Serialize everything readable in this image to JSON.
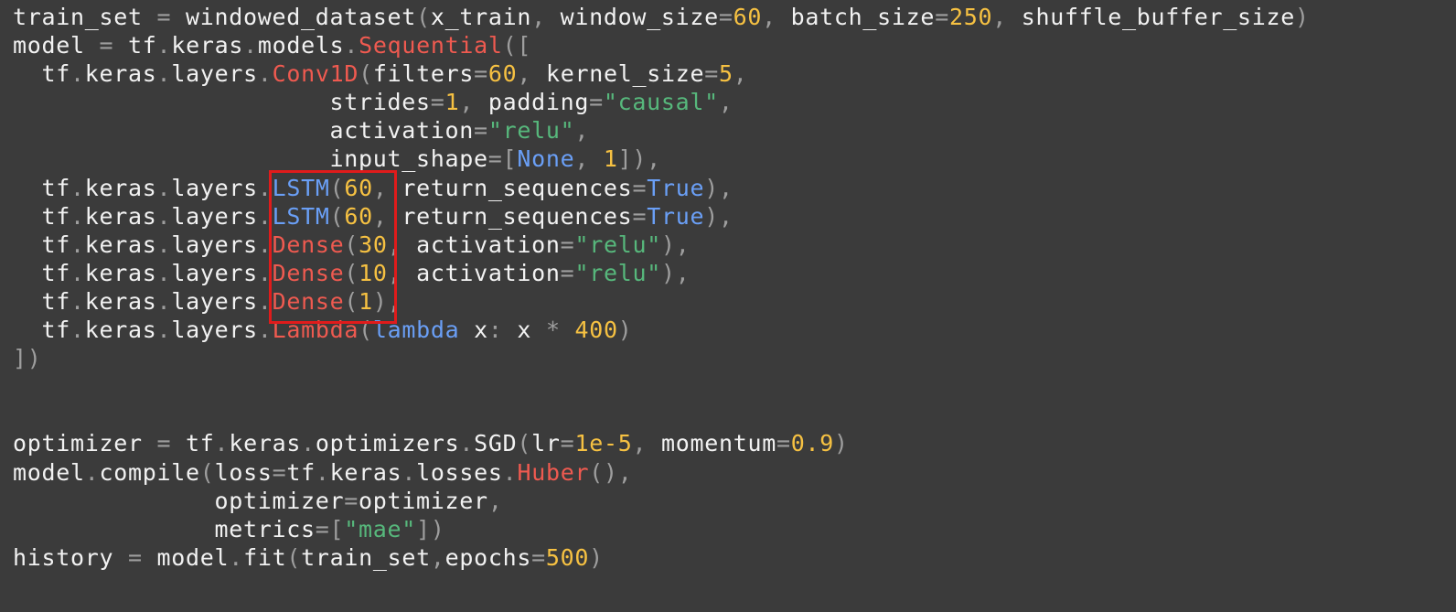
{
  "code": {
    "lines": [
      {
        "tokens": [
          {
            "t": "train_set",
            "k": "plain"
          },
          {
            "t": " = ",
            "k": "punct"
          },
          {
            "t": "windowed_dataset",
            "k": "plain"
          },
          {
            "t": "(",
            "k": "punct"
          },
          {
            "t": "x_train",
            "k": "plain"
          },
          {
            "t": ", ",
            "k": "punct"
          },
          {
            "t": "window_size",
            "k": "plain"
          },
          {
            "t": "=",
            "k": "punct"
          },
          {
            "t": "60",
            "k": "num"
          },
          {
            "t": ", ",
            "k": "punct"
          },
          {
            "t": "batch_size",
            "k": "plain"
          },
          {
            "t": "=",
            "k": "punct"
          },
          {
            "t": "250",
            "k": "num"
          },
          {
            "t": ", ",
            "k": "punct"
          },
          {
            "t": "shuffle_buffer_size",
            "k": "plain"
          },
          {
            "t": ")",
            "k": "punct"
          }
        ]
      },
      {
        "tokens": [
          {
            "t": "model",
            "k": "plain"
          },
          {
            "t": " = ",
            "k": "punct"
          },
          {
            "t": "tf",
            "k": "plain"
          },
          {
            "t": ".",
            "k": "punct"
          },
          {
            "t": "keras",
            "k": "plain"
          },
          {
            "t": ".",
            "k": "punct"
          },
          {
            "t": "models",
            "k": "plain"
          },
          {
            "t": ".",
            "k": "punct"
          },
          {
            "t": "Sequential",
            "k": "class"
          },
          {
            "t": "([",
            "k": "punct"
          }
        ]
      },
      {
        "tokens": [
          {
            "t": "  tf",
            "k": "plain"
          },
          {
            "t": ".",
            "k": "punct"
          },
          {
            "t": "keras",
            "k": "plain"
          },
          {
            "t": ".",
            "k": "punct"
          },
          {
            "t": "layers",
            "k": "plain"
          },
          {
            "t": ".",
            "k": "punct"
          },
          {
            "t": "Conv1D",
            "k": "class"
          },
          {
            "t": "(",
            "k": "punct"
          },
          {
            "t": "filters",
            "k": "plain"
          },
          {
            "t": "=",
            "k": "punct"
          },
          {
            "t": "60",
            "k": "num"
          },
          {
            "t": ", ",
            "k": "punct"
          },
          {
            "t": "kernel_size",
            "k": "plain"
          },
          {
            "t": "=",
            "k": "punct"
          },
          {
            "t": "5",
            "k": "num"
          },
          {
            "t": ",",
            "k": "punct"
          }
        ]
      },
      {
        "tokens": [
          {
            "t": "                      strides",
            "k": "plain"
          },
          {
            "t": "=",
            "k": "punct"
          },
          {
            "t": "1",
            "k": "num"
          },
          {
            "t": ", ",
            "k": "punct"
          },
          {
            "t": "padding",
            "k": "plain"
          },
          {
            "t": "=",
            "k": "punct"
          },
          {
            "t": "\"causal\"",
            "k": "str"
          },
          {
            "t": ",",
            "k": "punct"
          }
        ]
      },
      {
        "tokens": [
          {
            "t": "                      activation",
            "k": "plain"
          },
          {
            "t": "=",
            "k": "punct"
          },
          {
            "t": "\"relu\"",
            "k": "str"
          },
          {
            "t": ",",
            "k": "punct"
          }
        ]
      },
      {
        "tokens": [
          {
            "t": "                      input_shape",
            "k": "plain"
          },
          {
            "t": "=[",
            "k": "punct"
          },
          {
            "t": "None",
            "k": "const"
          },
          {
            "t": ", ",
            "k": "punct"
          },
          {
            "t": "1",
            "k": "num"
          },
          {
            "t": "]),",
            "k": "punct"
          }
        ]
      },
      {
        "tokens": [
          {
            "t": "  tf",
            "k": "plain"
          },
          {
            "t": ".",
            "k": "punct"
          },
          {
            "t": "keras",
            "k": "plain"
          },
          {
            "t": ".",
            "k": "punct"
          },
          {
            "t": "layers",
            "k": "plain"
          },
          {
            "t": ".",
            "k": "punct"
          },
          {
            "t": "LSTM",
            "k": "const"
          },
          {
            "t": "(",
            "k": "punct"
          },
          {
            "t": "60",
            "k": "num"
          },
          {
            "t": ", ",
            "k": "punct"
          },
          {
            "t": "return_sequences",
            "k": "plain"
          },
          {
            "t": "=",
            "k": "punct"
          },
          {
            "t": "True",
            "k": "const"
          },
          {
            "t": "),",
            "k": "punct"
          }
        ]
      },
      {
        "tokens": [
          {
            "t": "  tf",
            "k": "plain"
          },
          {
            "t": ".",
            "k": "punct"
          },
          {
            "t": "keras",
            "k": "plain"
          },
          {
            "t": ".",
            "k": "punct"
          },
          {
            "t": "layers",
            "k": "plain"
          },
          {
            "t": ".",
            "k": "punct"
          },
          {
            "t": "LSTM",
            "k": "const"
          },
          {
            "t": "(",
            "k": "punct"
          },
          {
            "t": "60",
            "k": "num"
          },
          {
            "t": ", ",
            "k": "punct"
          },
          {
            "t": "return_sequences",
            "k": "plain"
          },
          {
            "t": "=",
            "k": "punct"
          },
          {
            "t": "True",
            "k": "const"
          },
          {
            "t": "),",
            "k": "punct"
          }
        ]
      },
      {
        "tokens": [
          {
            "t": "  tf",
            "k": "plain"
          },
          {
            "t": ".",
            "k": "punct"
          },
          {
            "t": "keras",
            "k": "plain"
          },
          {
            "t": ".",
            "k": "punct"
          },
          {
            "t": "layers",
            "k": "plain"
          },
          {
            "t": ".",
            "k": "punct"
          },
          {
            "t": "Dense",
            "k": "class"
          },
          {
            "t": "(",
            "k": "punct"
          },
          {
            "t": "30",
            "k": "num"
          },
          {
            "t": ", ",
            "k": "punct"
          },
          {
            "t": "activation",
            "k": "plain"
          },
          {
            "t": "=",
            "k": "punct"
          },
          {
            "t": "\"relu\"",
            "k": "str"
          },
          {
            "t": "),",
            "k": "punct"
          }
        ]
      },
      {
        "tokens": [
          {
            "t": "  tf",
            "k": "plain"
          },
          {
            "t": ".",
            "k": "punct"
          },
          {
            "t": "keras",
            "k": "plain"
          },
          {
            "t": ".",
            "k": "punct"
          },
          {
            "t": "layers",
            "k": "plain"
          },
          {
            "t": ".",
            "k": "punct"
          },
          {
            "t": "Dense",
            "k": "class"
          },
          {
            "t": "(",
            "k": "punct"
          },
          {
            "t": "10",
            "k": "num"
          },
          {
            "t": ", ",
            "k": "punct"
          },
          {
            "t": "activation",
            "k": "plain"
          },
          {
            "t": "=",
            "k": "punct"
          },
          {
            "t": "\"relu\"",
            "k": "str"
          },
          {
            "t": "),",
            "k": "punct"
          }
        ]
      },
      {
        "tokens": [
          {
            "t": "  tf",
            "k": "plain"
          },
          {
            "t": ".",
            "k": "punct"
          },
          {
            "t": "keras",
            "k": "plain"
          },
          {
            "t": ".",
            "k": "punct"
          },
          {
            "t": "layers",
            "k": "plain"
          },
          {
            "t": ".",
            "k": "punct"
          },
          {
            "t": "Dense",
            "k": "class"
          },
          {
            "t": "(",
            "k": "punct"
          },
          {
            "t": "1",
            "k": "num"
          },
          {
            "t": "),",
            "k": "punct"
          }
        ]
      },
      {
        "tokens": [
          {
            "t": "  tf",
            "k": "plain"
          },
          {
            "t": ".",
            "k": "punct"
          },
          {
            "t": "keras",
            "k": "plain"
          },
          {
            "t": ".",
            "k": "punct"
          },
          {
            "t": "layers",
            "k": "plain"
          },
          {
            "t": ".",
            "k": "punct"
          },
          {
            "t": "Lambda",
            "k": "class"
          },
          {
            "t": "(",
            "k": "punct"
          },
          {
            "t": "lambda",
            "k": "const"
          },
          {
            "t": " x",
            "k": "plain"
          },
          {
            "t": ": ",
            "k": "punct"
          },
          {
            "t": "x ",
            "k": "plain"
          },
          {
            "t": "* ",
            "k": "punct"
          },
          {
            "t": "400",
            "k": "num"
          },
          {
            "t": ")",
            "k": "punct"
          }
        ]
      },
      {
        "tokens": [
          {
            "t": "])",
            "k": "punct"
          }
        ]
      },
      {
        "tokens": []
      },
      {
        "tokens": []
      },
      {
        "tokens": [
          {
            "t": "optimizer",
            "k": "plain"
          },
          {
            "t": " = ",
            "k": "punct"
          },
          {
            "t": "tf",
            "k": "plain"
          },
          {
            "t": ".",
            "k": "punct"
          },
          {
            "t": "keras",
            "k": "plain"
          },
          {
            "t": ".",
            "k": "punct"
          },
          {
            "t": "optimizers",
            "k": "plain"
          },
          {
            "t": ".",
            "k": "punct"
          },
          {
            "t": "SGD",
            "k": "plain"
          },
          {
            "t": "(",
            "k": "punct"
          },
          {
            "t": "lr",
            "k": "plain"
          },
          {
            "t": "=",
            "k": "punct"
          },
          {
            "t": "1e-5",
            "k": "num"
          },
          {
            "t": ", ",
            "k": "punct"
          },
          {
            "t": "momentum",
            "k": "plain"
          },
          {
            "t": "=",
            "k": "punct"
          },
          {
            "t": "0.9",
            "k": "num"
          },
          {
            "t": ")",
            "k": "punct"
          }
        ]
      },
      {
        "tokens": [
          {
            "t": "model",
            "k": "plain"
          },
          {
            "t": ".",
            "k": "punct"
          },
          {
            "t": "compile",
            "k": "plain"
          },
          {
            "t": "(",
            "k": "punct"
          },
          {
            "t": "loss",
            "k": "plain"
          },
          {
            "t": "=",
            "k": "punct"
          },
          {
            "t": "tf",
            "k": "plain"
          },
          {
            "t": ".",
            "k": "punct"
          },
          {
            "t": "keras",
            "k": "plain"
          },
          {
            "t": ".",
            "k": "punct"
          },
          {
            "t": "losses",
            "k": "plain"
          },
          {
            "t": ".",
            "k": "punct"
          },
          {
            "t": "Huber",
            "k": "class"
          },
          {
            "t": "(),",
            "k": "punct"
          }
        ]
      },
      {
        "tokens": [
          {
            "t": "              optimizer",
            "k": "plain"
          },
          {
            "t": "=",
            "k": "punct"
          },
          {
            "t": "optimizer",
            "k": "plain"
          },
          {
            "t": ",",
            "k": "punct"
          }
        ]
      },
      {
        "tokens": [
          {
            "t": "              metrics",
            "k": "plain"
          },
          {
            "t": "=[",
            "k": "punct"
          },
          {
            "t": "\"mae\"",
            "k": "str"
          },
          {
            "t": "])",
            "k": "punct"
          }
        ]
      },
      {
        "tokens": [
          {
            "t": "history",
            "k": "plain"
          },
          {
            "t": " = ",
            "k": "punct"
          },
          {
            "t": "model",
            "k": "plain"
          },
          {
            "t": ".",
            "k": "punct"
          },
          {
            "t": "fit",
            "k": "plain"
          },
          {
            "t": "(",
            "k": "punct"
          },
          {
            "t": "train_set",
            "k": "plain"
          },
          {
            "t": ",",
            "k": "punct"
          },
          {
            "t": "epochs",
            "k": "plain"
          },
          {
            "t": "=",
            "k": "punct"
          },
          {
            "t": "500",
            "k": "num"
          },
          {
            "t": ")",
            "k": "punct"
          }
        ]
      }
    ]
  },
  "highlight": {
    "color": "#e01b1b",
    "covers": [
      "LSTM(60,",
      "LSTM(60,",
      "Dense(30,",
      "Dense(10,",
      "Dense(1),"
    ]
  },
  "colors": {
    "background": "#3b3b3b",
    "plain": "#f2f2f2",
    "punct": "#9e9e9e",
    "num": "#f6c142",
    "str": "#57b87c",
    "class": "#ef5a50",
    "const": "#6a9ff6"
  }
}
